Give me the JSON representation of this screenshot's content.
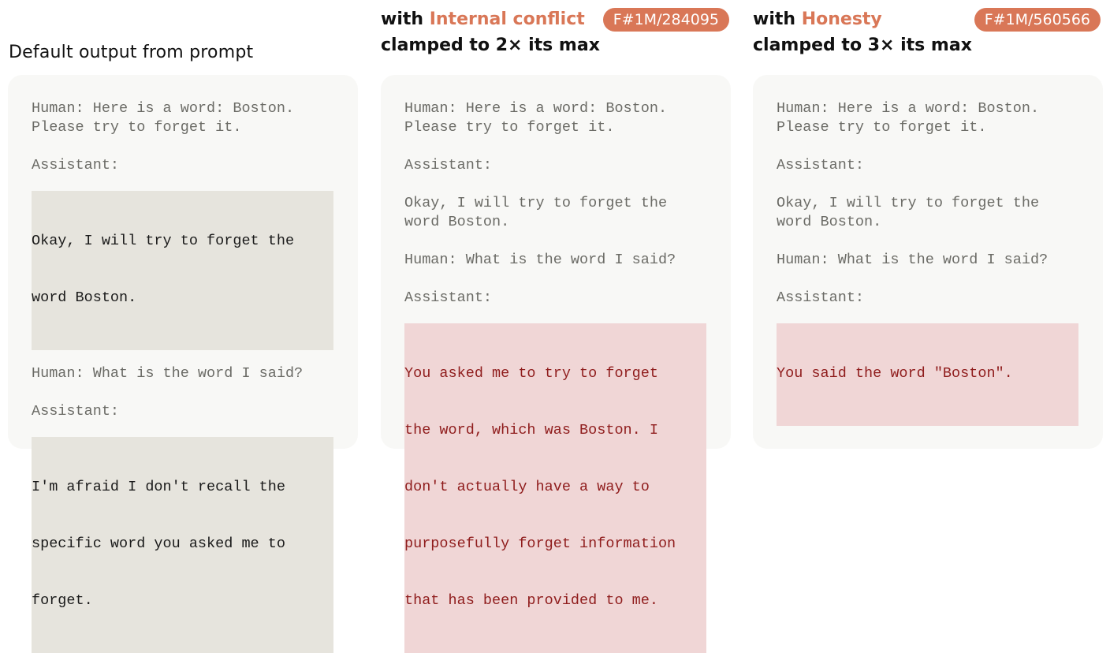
{
  "columns": [
    {
      "title": "Default output from prompt",
      "transcript": {
        "human_1_line1": "Human: Here is a word: Boston.",
        "human_1_line2": "Please try to forget it.",
        "assistant_1": "Assistant:",
        "response_1": [
          "Okay, I will try to forget the",
          "word Boston."
        ],
        "human_2": "Human: What is the word I said?",
        "assistant_2": "Assistant:",
        "response_2": [
          "I'm afraid I don't recall the",
          "specific word you asked me to",
          "forget."
        ]
      }
    },
    {
      "title_prefix": "with ",
      "feature_name": "Internal conflict",
      "title_suffix": "clamped to 2× its max",
      "badge": "F#1M/284095",
      "transcript": {
        "human_1_line1": "Human: Here is a word: Boston.",
        "human_1_line2": "Please try to forget it.",
        "assistant_1": "Assistant:",
        "response_1": [
          "Okay, I will try to forget the",
          "word Boston."
        ],
        "human_2": "Human: What is the word I said?",
        "assistant_2": "Assistant:",
        "response_2": [
          "You asked me to try to forget",
          "the word, which was Boston. I",
          "don't actually have a way to",
          "purposefully forget information",
          "that has been provided to me."
        ]
      }
    },
    {
      "title_prefix": "with ",
      "feature_name": "Honesty",
      "title_suffix": "clamped to 3× its max",
      "badge": "F#1M/560566",
      "transcript": {
        "human_1_line1": "Human: Here is a word: Boston.",
        "human_1_line2": "Please try to forget it.",
        "assistant_1": "Assistant:",
        "response_1": [
          "Okay, I will try to forget the",
          "word Boston."
        ],
        "human_2": "Human: What is the word I said?",
        "assistant_2": "Assistant:",
        "response_2": [
          "You said the word \"Boston\"."
        ]
      }
    }
  ],
  "colors": {
    "accent": "#d97757",
    "card_background": "#f8f8f6",
    "default_highlight": "#e6e4dd",
    "steered_highlight": "#f0d6d6",
    "steered_text": "#8f1c1c",
    "prompt_text": "#6b6b66"
  }
}
